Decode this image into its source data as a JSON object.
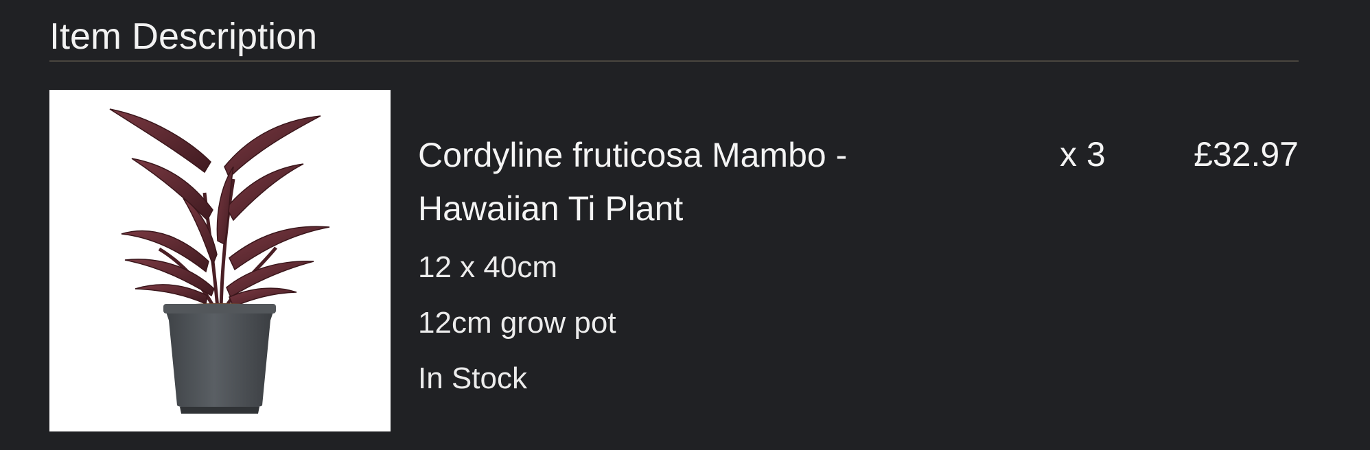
{
  "section": {
    "title": "Item Description"
  },
  "item": {
    "image_icon": "plant-product-photo",
    "name": "Cordyline fruticosa Mambo - Hawaiian Ti Plant",
    "size": "12 x 40cm",
    "pot": "12cm grow pot",
    "stock_status": "In Stock",
    "quantity": "x 3",
    "price": "£32.97"
  },
  "colors": {
    "background": "#202124",
    "divider": "#4a463f",
    "text": "#f2f2f2",
    "leaf": "#5e2a30",
    "pot": "#4b4f53"
  }
}
